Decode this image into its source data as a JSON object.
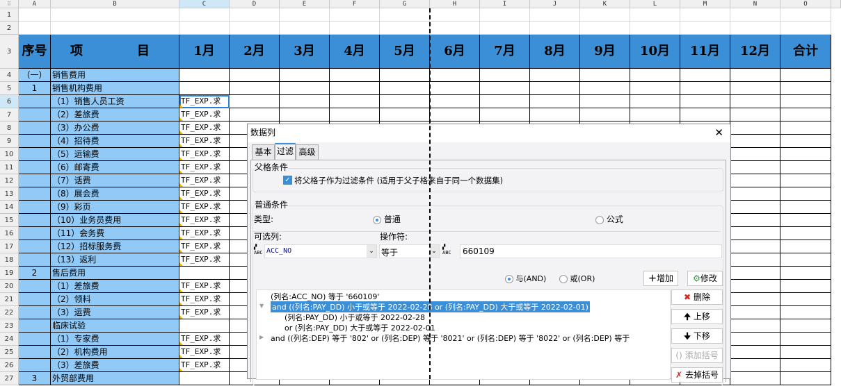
{
  "columns": [
    "A",
    "B",
    "C",
    "D",
    "E",
    "F",
    "G",
    "H",
    "I",
    "J",
    "K",
    "L",
    "M",
    "N",
    "O"
  ],
  "header": {
    "seq": "序号",
    "item": "项　　目",
    "months": [
      "1月",
      "2月",
      "3月",
      "4月",
      "5月",
      "6月",
      "7月",
      "8月",
      "9月",
      "10月",
      "11月",
      "12月"
    ],
    "total": "合计"
  },
  "rows": [
    {
      "n": "4",
      "a": "（一）",
      "b": "销售费用",
      "c": ""
    },
    {
      "n": "5",
      "a": "1",
      "b": "销售机构费用",
      "c": ""
    },
    {
      "n": "6",
      "a": "",
      "b": "（1）销售人员工资",
      "c": "TF_EXP.求"
    },
    {
      "n": "7",
      "a": "",
      "b": "（2）差旅费",
      "c": "TF_EXP.求"
    },
    {
      "n": "8",
      "a": "",
      "b": "（3）办公费",
      "c": "TF_EXP.求"
    },
    {
      "n": "9",
      "a": "",
      "b": "（4）招待费",
      "c": "TF_EXP.求"
    },
    {
      "n": "10",
      "a": "",
      "b": "（5）运输费",
      "c": "TF_EXP.求"
    },
    {
      "n": "11",
      "a": "",
      "b": "（6）邮寄费",
      "c": "TF_EXP.求"
    },
    {
      "n": "12",
      "a": "",
      "b": "（7）话费",
      "c": "TF_EXP.求"
    },
    {
      "n": "13",
      "a": "",
      "b": "（8）展会费",
      "c": "TF_EXP.求"
    },
    {
      "n": "14",
      "a": "",
      "b": "（9）彩页",
      "c": "TF_EXP.求"
    },
    {
      "n": "15",
      "a": "",
      "b": "（10）业务员费用",
      "c": "TF_EXP.求"
    },
    {
      "n": "16",
      "a": "",
      "b": "（11）会务费",
      "c": "TF_EXP.求"
    },
    {
      "n": "17",
      "a": "",
      "b": "（12）招标服务费",
      "c": "TF_EXP.求"
    },
    {
      "n": "18",
      "a": "",
      "b": "（13）返利",
      "c": "TF_EXP.求"
    },
    {
      "n": "19",
      "a": "2",
      "b": "售后费用",
      "c": ""
    },
    {
      "n": "20",
      "a": "",
      "b": "（1）差旅费",
      "c": "TF_EXP.求"
    },
    {
      "n": "21",
      "a": "",
      "b": "（2）领料",
      "c": "TF_EXP.求"
    },
    {
      "n": "22",
      "a": "",
      "b": "（3）运费",
      "c": "TF_EXP.求"
    },
    {
      "n": "23",
      "a": "",
      "b": "临床试验",
      "c": ""
    },
    {
      "n": "24",
      "a": "",
      "b": "（1）专家费",
      "c": "TF_EXP.求"
    },
    {
      "n": "25",
      "a": "",
      "b": "（2）机构费用",
      "c": "TF_EXP.求"
    },
    {
      "n": "26",
      "a": "",
      "b": "（3）差旅费",
      "c": "TF_EXP.求"
    },
    {
      "n": "27",
      "a": "3",
      "b": "外贸部费用",
      "c": ""
    }
  ],
  "row_numbers_top": [
    "1",
    "2",
    "3"
  ],
  "dialog": {
    "title": "数据列",
    "close": "✕",
    "tabs": [
      "基本",
      "过滤",
      "高级"
    ],
    "parent_group": "父格条件",
    "parent_checkbox": "将父格子作为过滤条件 (适用于父子格来自于同一个数据集)",
    "normal_group": "普通条件",
    "type_label": "类型:",
    "type_normal": "普通",
    "type_formula": "公式",
    "column_label": "可选列:",
    "operator_label": "操作符:",
    "column_value": "ACC_NO",
    "operator_value": "等于",
    "value": "660109",
    "and_label": "与(AND)",
    "or_label": "或(OR)",
    "add": "增加",
    "modify": "修改",
    "delete": "删除",
    "up": "上移",
    "down": "下移",
    "add_paren": "添加括号",
    "remove_paren": "去掉括号",
    "tree": [
      "(列名:ACC_NO) 等于 '660109'",
      "and ((列名:PAY_DD) 小于或等于 2022-02-28 or (列名:PAY_DD) 大于或等于 2022-02-01)",
      "(列名:PAY_DD) 小于或等于 2022-02-28",
      "or  (列名:PAY_DD) 大于或等于 2022-02-01",
      "and ((列名:DEP) 等于 '802' or (列名:DEP) 等于 '8021' or (列名:DEP) 等于 '8022' or (列名:DEP) 等于"
    ]
  }
}
